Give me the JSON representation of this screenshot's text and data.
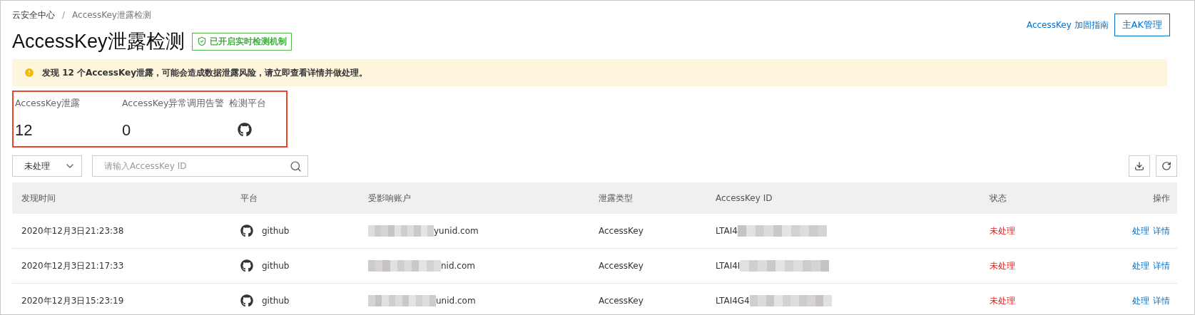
{
  "breadcrumb": [
    {
      "label": "云安全中心"
    },
    {
      "label": "AccessKey泄露检测"
    }
  ],
  "breadcrumb_separator": "/",
  "title": "AccessKey泄露检测",
  "status_badge": "已开启实时检测机制",
  "header_links": {
    "guide": "AccessKey 加固指南",
    "button": "主AK管理"
  },
  "alert": "发现 12 个AccessKey泄露，可能会造成数据泄露风险，请立即查看详情并做处理。",
  "stats": [
    {
      "kind": "number",
      "label": "AccessKey泄露",
      "value": "12"
    },
    {
      "kind": "number",
      "label": "AccessKey异常调用告警",
      "value": "0"
    },
    {
      "kind": "platform",
      "label": "检测平台"
    }
  ],
  "filter": {
    "value": "未处理"
  },
  "search": {
    "placeholder": "请输入AccessKey ID"
  },
  "table": {
    "columns": [
      "发现时间",
      "平台",
      "受影响账户",
      "泄露类型",
      "AccessKey ID",
      "状态",
      "操作"
    ],
    "rows": [
      {
        "time": "2020年12月3日21:23:38",
        "platform": "github",
        "account": "yunid.com",
        "type": "AccessKey",
        "key_id": "LTAI4",
        "status": "未处理",
        "actions": [
          "处理",
          "详情"
        ]
      },
      {
        "time": "2020年12月3日21:17:33",
        "platform": "github",
        "account": "nid.com",
        "type": "AccessKey",
        "key_id": "LTAI4I",
        "status": "未处理",
        "actions": [
          "处理",
          "详情"
        ]
      },
      {
        "time": "2020年12月3日15:23:19",
        "platform": "github",
        "account": "unid.com",
        "type": "AccessKey",
        "key_id": "LTAI4G4",
        "status": "未处理",
        "actions": [
          "处理",
          "详情"
        ]
      }
    ]
  }
}
